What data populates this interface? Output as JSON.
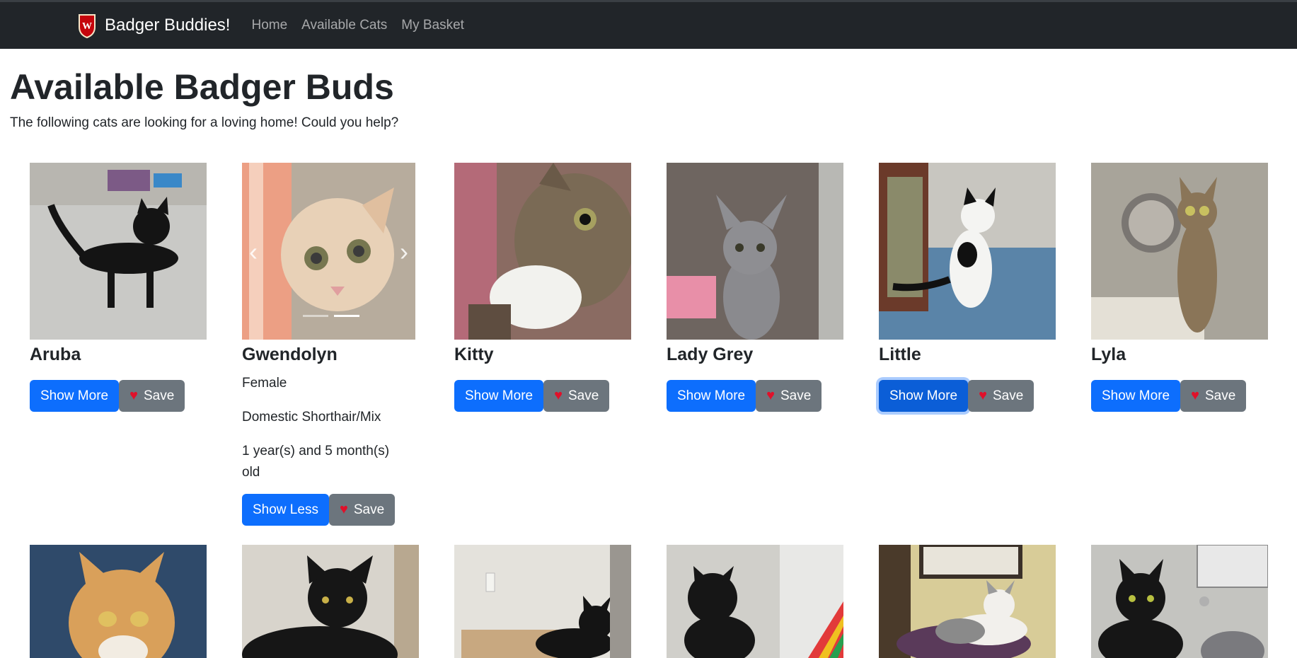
{
  "navbar": {
    "brand": "Badger Buddies!",
    "links": [
      "Home",
      "Available Cats",
      "My Basket"
    ]
  },
  "page": {
    "title": "Available Badger Buds",
    "subtitle": "The following cats are looking for a loving home! Could you help?"
  },
  "buttons": {
    "show_more": "Show More",
    "show_less": "Show Less",
    "save": "Save"
  },
  "cats_row1": [
    {
      "name": "Aruba"
    },
    {
      "name": "Gwendolyn",
      "expanded": true,
      "gender": "Female",
      "breed": "Domestic Shorthair/Mix",
      "age": "1 year(s) and 5 month(s) old"
    },
    {
      "name": "Kitty"
    },
    {
      "name": "Lady Grey"
    },
    {
      "name": "Little"
    },
    {
      "name": "Lyla"
    }
  ],
  "colors": {
    "navbar_bg": "#212529",
    "primary": "#0d6efd",
    "secondary": "#6c757d",
    "heart": "#e0102a"
  }
}
